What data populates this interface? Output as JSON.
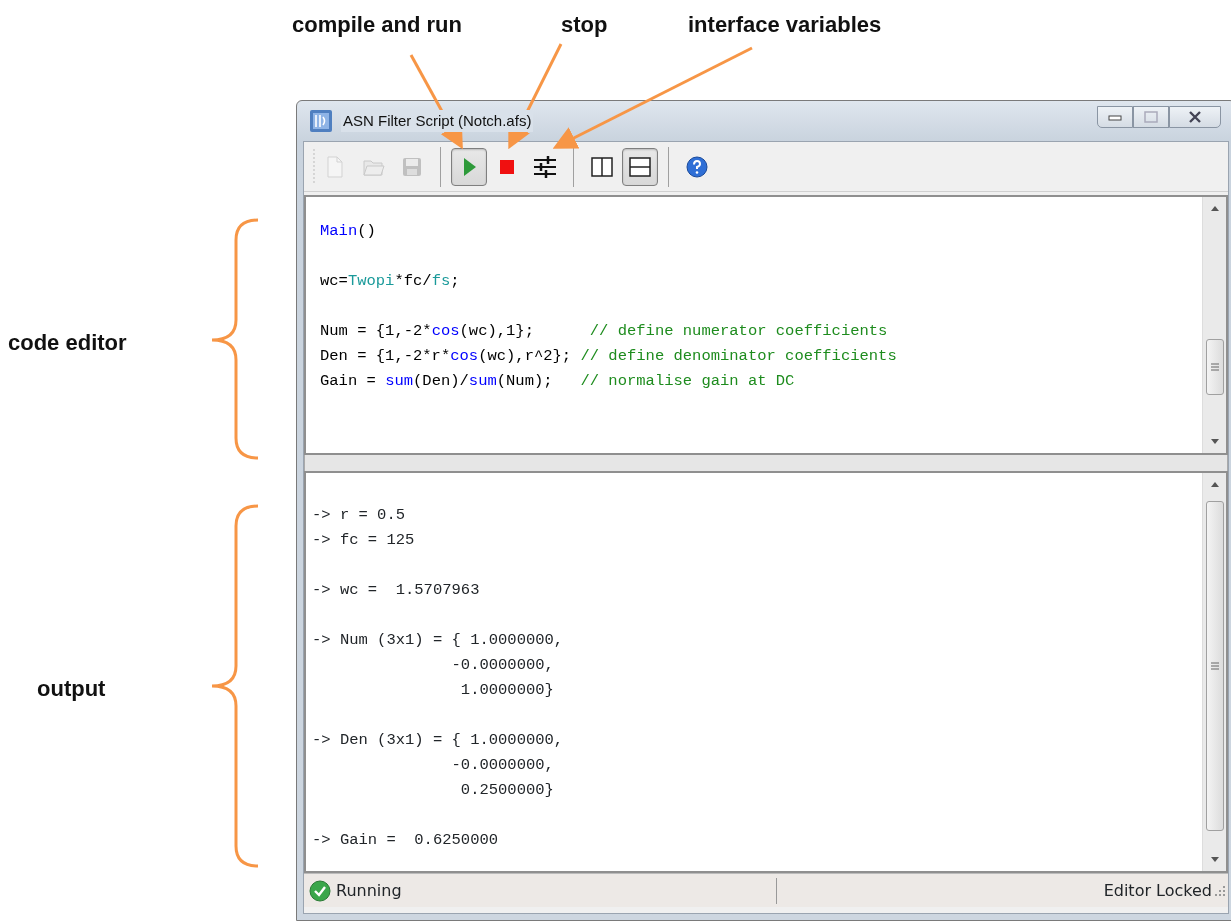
{
  "annotations": {
    "top": [
      {
        "label": "compile and run"
      },
      {
        "label": "stop"
      },
      {
        "label": "interface variables"
      }
    ],
    "side": [
      {
        "label": "code editor"
      },
      {
        "label": "output"
      }
    ]
  },
  "window": {
    "title": "ASN Filter Script (Notch.afs)"
  },
  "toolbar": [
    {
      "kind": "new",
      "disabled": true,
      "pressed": false
    },
    {
      "kind": "open",
      "disabled": true,
      "pressed": false
    },
    {
      "kind": "save",
      "disabled": true,
      "pressed": false
    },
    {
      "kind": "sep"
    },
    {
      "kind": "run",
      "disabled": false,
      "pressed": true
    },
    {
      "kind": "stop",
      "disabled": false,
      "pressed": false
    },
    {
      "kind": "variables",
      "disabled": false,
      "pressed": false
    },
    {
      "kind": "sep"
    },
    {
      "kind": "split-vertical",
      "disabled": false,
      "pressed": false
    },
    {
      "kind": "split-horizontal",
      "disabled": false,
      "pressed": true
    },
    {
      "kind": "sep"
    },
    {
      "kind": "help",
      "disabled": false,
      "pressed": false
    }
  ],
  "editor": {
    "blocks": [
      {
        "lines": [
          {
            "tokens": [
              {
                "text": "Main",
                "kind": "keyword"
              },
              {
                "text": "()",
                "kind": "plain"
              }
            ]
          }
        ]
      },
      {
        "lines": [
          {
            "tokens": [
              {
                "text": "wc=",
                "kind": "plain"
              },
              {
                "text": "Twopi",
                "kind": "constant"
              },
              {
                "text": "*fc/",
                "kind": "plain"
              },
              {
                "text": "fs",
                "kind": "constant"
              },
              {
                "text": ";",
                "kind": "plain"
              }
            ]
          }
        ]
      },
      {
        "lines": [
          {
            "tokens": [
              {
                "text": "Num = {1,-2*",
                "kind": "plain"
              },
              {
                "text": "cos",
                "kind": "keyword"
              },
              {
                "text": "(wc),1};      ",
                "kind": "plain"
              },
              {
                "text": "// define numerator coefficients",
                "kind": "comment"
              }
            ]
          },
          {
            "tokens": [
              {
                "text": "Den = {1,-2*r*",
                "kind": "plain"
              },
              {
                "text": "cos",
                "kind": "keyword"
              },
              {
                "text": "(wc),r^2}; ",
                "kind": "plain"
              },
              {
                "text": "// define denominator coefficients",
                "kind": "comment"
              }
            ]
          },
          {
            "tokens": [
              {
                "text": "Gain = ",
                "kind": "plain"
              },
              {
                "text": "sum",
                "kind": "keyword"
              },
              {
                "text": "(Den)/",
                "kind": "plain"
              },
              {
                "text": "sum",
                "kind": "keyword"
              },
              {
                "text": "(Num);   ",
                "kind": "plain"
              },
              {
                "text": "// normalise gain at DC",
                "kind": "comment"
              }
            ]
          }
        ]
      }
    ]
  },
  "output": {
    "blocks": [
      {
        "lines": [
          "-> r = 0.5",
          "-> fc = 125"
        ]
      },
      {
        "lines": [
          "-> wc =  1.5707963"
        ]
      },
      {
        "lines": [
          "-> Num (3x1) = { 1.0000000,",
          "               -0.0000000,",
          "                1.0000000}"
        ]
      },
      {
        "lines": [
          "-> Den (3x1) = { 1.0000000,",
          "               -0.0000000,",
          "                0.2500000}"
        ]
      },
      {
        "lines": [
          "-> Gain =  0.6250000"
        ]
      }
    ]
  },
  "status_bar": {
    "state": "Running",
    "ok": true,
    "right": "Editor Locked"
  }
}
